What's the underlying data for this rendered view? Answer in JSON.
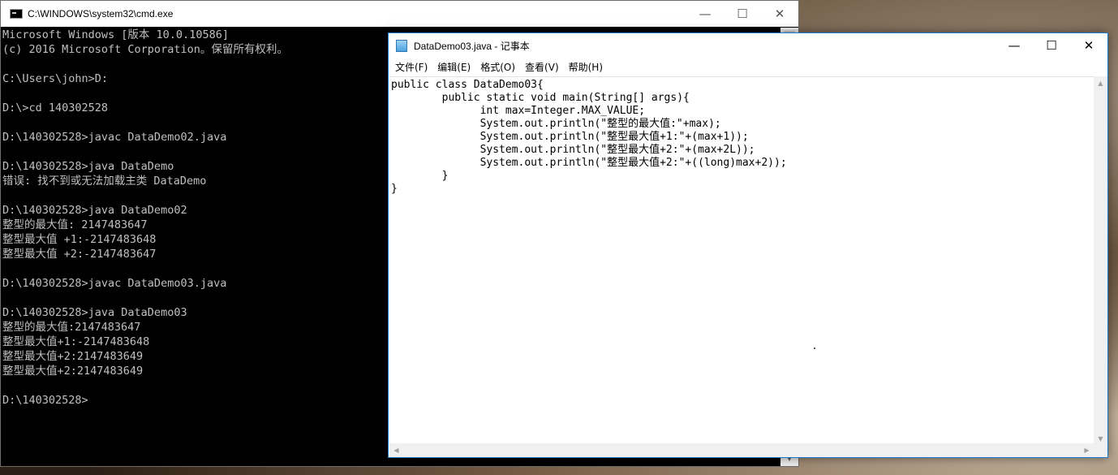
{
  "cmd": {
    "title": "C:\\WINDOWS\\system32\\cmd.exe",
    "minimize": "—",
    "maximize": "☐",
    "close": "✕",
    "lines": [
      "Microsoft Windows [版本 10.0.10586]",
      "(c) 2016 Microsoft Corporation。保留所有权利。",
      "",
      "C:\\Users\\john>D:",
      "",
      "D:\\>cd 140302528",
      "",
      "D:\\140302528>javac DataDemo02.java",
      "",
      "D:\\140302528>java DataDemo",
      "错误: 找不到或无法加载主类 DataDemo",
      "",
      "D:\\140302528>java DataDemo02",
      "整型的最大值: 2147483647",
      "整型最大值 +1:-2147483648",
      "整型最大值 +2:-2147483647",
      "",
      "D:\\140302528>javac DataDemo03.java",
      "",
      "D:\\140302528>java DataDemo03",
      "整型的最大值:2147483647",
      "整型最大值+1:-2147483648",
      "整型最大值+2:2147483649",
      "整型最大值+2:2147483649",
      "",
      "D:\\140302528>"
    ]
  },
  "notepad": {
    "title": "DataDemo03.java - 记事本",
    "minimize": "—",
    "maximize": "☐",
    "close": "✕",
    "menu": [
      "文件(F)",
      "编辑(E)",
      "格式(O)",
      "查看(V)",
      "帮助(H)"
    ],
    "content": "public class DataDemo03{\n        public static void main(String[] args){\n              int max=Integer.MAX_VALUE;\n              System.out.println(\"整型的最大值:\"+max);\n              System.out.println(\"整型最大值+1:\"+(max+1));\n              System.out.println(\"整型最大值+2:\"+(max+2L));\n              System.out.println(\"整型最大值+2:\"+((long)max+2));\n        }\n}"
  }
}
